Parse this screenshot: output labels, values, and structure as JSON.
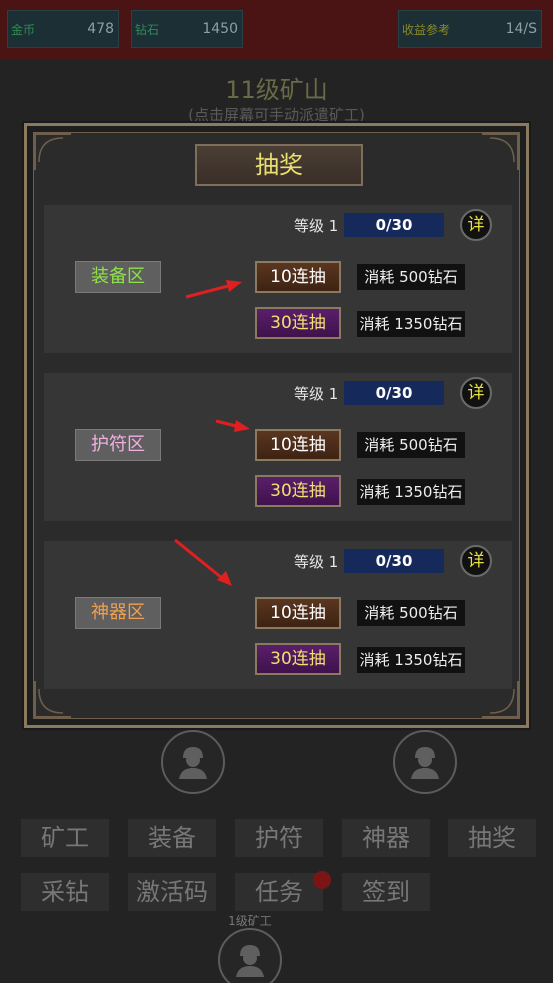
{
  "resources": [
    {
      "label": "金币",
      "value": "478"
    },
    {
      "label": "钻石",
      "value": "1450"
    },
    {
      "label": "收益参考",
      "value": "14/S"
    }
  ],
  "mine": {
    "title": "11级矿山",
    "subtitle": "(点击屏幕可手动派遣矿工)"
  },
  "dialog": {
    "title": "抽奖",
    "sections": [
      {
        "name": "装备区",
        "name_color": "#8ee04a",
        "level_label": "等级 1",
        "progress_text": "0/30",
        "progress": 0,
        "detail_label": "详",
        "draw10_label": "10连抽",
        "draw10_cost": "消耗 500钻石",
        "draw30_label": "30连抽",
        "draw30_cost": "消耗 1350钻石"
      },
      {
        "name": "护符区",
        "name_color": "#f0b0e0",
        "level_label": "等级 1",
        "progress_text": "0/30",
        "progress": 0,
        "detail_label": "详",
        "draw10_label": "10连抽",
        "draw10_cost": "消耗 500钻石",
        "draw30_label": "30连抽",
        "draw30_cost": "消耗 1350钻石"
      },
      {
        "name": "神器区",
        "name_color": "#f0a050",
        "level_label": "等级 1",
        "progress_text": "0/30",
        "progress": 0,
        "detail_label": "详",
        "draw10_label": "10连抽",
        "draw10_cost": "消耗 500钻石",
        "draw30_label": "30连抽",
        "draw30_cost": "消耗 1350钻石"
      }
    ]
  },
  "menu": {
    "row1": [
      "矿工",
      "装备",
      "护符",
      "神器",
      "抽奖"
    ],
    "row2": [
      "采钻",
      "激活码",
      "任务",
      "签到"
    ]
  },
  "miner_label": "1级矿工",
  "colors": {
    "arrow": "#e02020",
    "title_text": "#e8e070"
  },
  "icons": [
    "miner-avatar-icon",
    "arrow-icon"
  ]
}
